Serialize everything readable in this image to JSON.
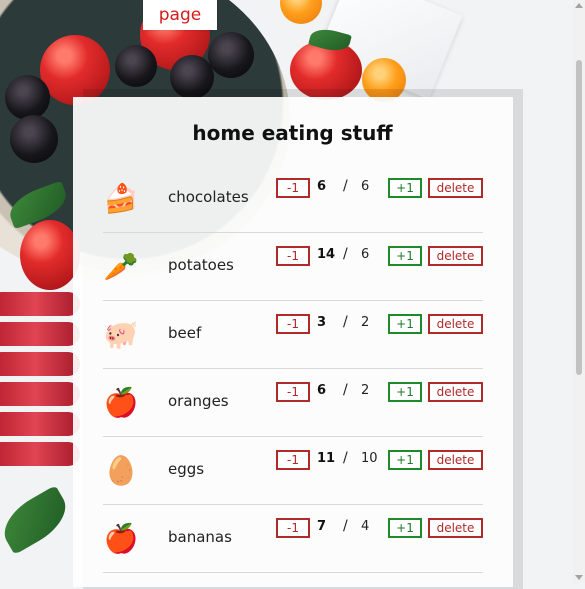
{
  "tab": {
    "label": "page"
  },
  "title": "home eating stuff",
  "buttons": {
    "minus": "-1",
    "plus": "+1",
    "delete": "delete"
  },
  "items": [
    {
      "name": "chocolates",
      "icon": "cake-icon",
      "glyph": "🍰",
      "count": "6",
      "goal": "6"
    },
    {
      "name": "potatoes",
      "icon": "carrot-icon",
      "glyph": "🥕",
      "count": "14",
      "goal": "6"
    },
    {
      "name": "beef",
      "icon": "pig-icon",
      "glyph": "🐖",
      "count": "3",
      "goal": "2"
    },
    {
      "name": "oranges",
      "icon": "apple-icon",
      "glyph": "🍎",
      "count": "6",
      "goal": "2"
    },
    {
      "name": "eggs",
      "icon": "egg-icon",
      "glyph": "🥚",
      "count": "11",
      "goal": "10"
    },
    {
      "name": "bananas",
      "icon": "apple-icon",
      "glyph": "🍎",
      "count": "7",
      "goal": "4"
    }
  ],
  "colors": {
    "accent_red": "#b02a2a",
    "accent_green": "#1f8a2a",
    "tab_text": "#d61a1a"
  }
}
